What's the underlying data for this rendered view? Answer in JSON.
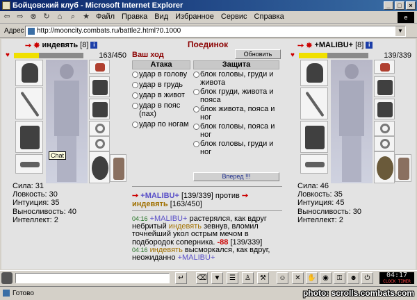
{
  "window": {
    "title": "Бойцовский клуб - Microsoft Internet Explorer"
  },
  "menu": [
    "Файл",
    "Правка",
    "Вид",
    "Избранное",
    "Сервис",
    "Справка"
  ],
  "address": {
    "label": "Адрес",
    "url": "http://mooncity.combats.ru/battle2.html?0.1000"
  },
  "left_fighter": {
    "name": "индевять",
    "level": "[8]",
    "hp_text": "163/450",
    "hp_fraction": 0.362,
    "chat_tooltip": "Chat",
    "stats": [
      "Сила: 31",
      "Ловкость: 30",
      "Интуиция: 35",
      "Выносливость: 40",
      "Интеллект: 2"
    ]
  },
  "right_fighter": {
    "name": "+MALIBU+",
    "level": "[8]",
    "hp_text": "139/339",
    "hp_fraction": 0.41,
    "stats": [
      "Сила: 46",
      "Ловкость: 35",
      "Интуиция: 45",
      "Выносливость: 30",
      "Интеллект: 2"
    ]
  },
  "battle": {
    "title": "Поединок",
    "your_turn": "Ваш ход",
    "refresh": "Обновить",
    "attack_header": "Атака",
    "defense_header": "Защита",
    "attacks": [
      "удар в голову",
      "удар в грудь",
      "удар в живот",
      "удар в пояс (пах)",
      "удар по ногам"
    ],
    "defenses": [
      "блок головы, груди и живота",
      "блок груди, живота и пояса",
      "блок живота, пояса и ног",
      "блок головы, пояса и ног",
      "блок головы, груди и ног"
    ],
    "go": "Вперед !!!",
    "vs": {
      "p1": "+MALIBU+",
      "p1_hp": "[139/339]",
      "against": "против",
      "p2": "индевять",
      "p2_hp": "[163/450]"
    },
    "log": [
      {
        "time": "04:16",
        "actor": "+MALIBU+",
        "text": "растерялся, как вдруг небритый",
        "target": "индевять",
        "text2": "зевнув, вломил точнейший укол острым мечом в подбородок соперника.",
        "dmg": "-88",
        "hp": "[139/339]"
      },
      {
        "time": "04:16",
        "actor": "индевять",
        "text": "высморкался, как вдруг, неожиданно",
        "target": "+MALIBU+"
      }
    ]
  },
  "clock": {
    "time": "04:17",
    "sub": "CLOCK TIMER"
  },
  "status": {
    "text": "Готово",
    "watermark": "photo: scrolls.combats.com"
  }
}
